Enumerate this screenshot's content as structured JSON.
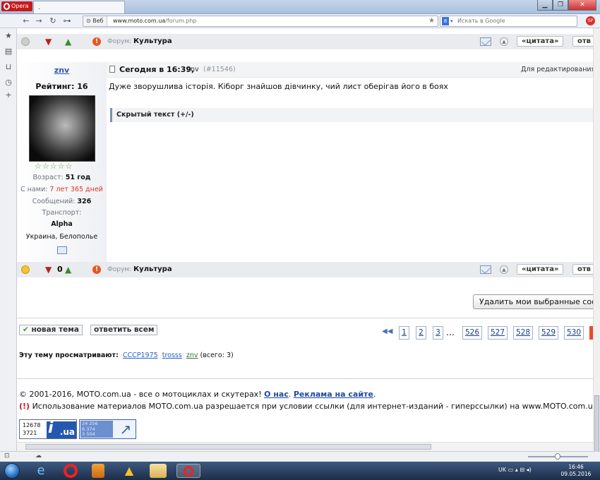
{
  "browser": {
    "app_name": "Opera",
    "tab_title": ".",
    "address_prefix": "Веб",
    "url_domain": "www.moto.com.ua",
    "url_path": "/forum.php",
    "search_placeholder": "Искать в Google",
    "search_engine_letter": "8",
    "sp_badge": "SP"
  },
  "post": {
    "top_bar": {
      "forum_label": "Форум:",
      "forum_name": "Культура",
      "quote_label": "«цитата»",
      "reply_label": "отв"
    },
    "author": {
      "name": "znv",
      "rating": "Рейтинг: 16",
      "age_label": "Возраст:",
      "age_value": "51 год",
      "since_label": "С нами:",
      "since_value": "7 лет 365 дней",
      "messages_label": "Сообщений:",
      "messages_value": "326",
      "transport_label": "Транспорт:",
      "transport_value": "Alpha",
      "location": "Украина, Белополье"
    },
    "header": {
      "date": "Сегодня в 16:39,",
      "author": "znv",
      "post_id": "(#11546)",
      "edit_note": "Для редактирования:"
    },
    "body": "Дуже зворушлива історія. Кіборг знайшов дівчинку, чий лист оберігав його в боях",
    "hidden_text_label": "Скрытый текст (+/-)",
    "bottom_bar": {
      "minus_count": "0",
      "forum_label": "Форум:",
      "forum_name": "Культура",
      "quote_label": "«цитата»",
      "reply_label": "отв"
    }
  },
  "delete_button": "Удалить мои выбранные сообщения",
  "thread_buttons": {
    "new_topic": "новая тема",
    "reply_all": "ответить всем"
  },
  "pagination": {
    "pages": [
      "1",
      "2",
      "3",
      "526",
      "527",
      "528",
      "529",
      "530"
    ],
    "ellipsis": "…"
  },
  "viewers": {
    "label": "Эту тему просматривают:",
    "users": [
      "CCCP1975",
      "trosss",
      "znv"
    ],
    "total": "(всего: 3)"
  },
  "footer": {
    "copyright": "© 2001-2016, MOTO.com.ua - все о мотоциклах и скутерах!",
    "about_link": "О нас",
    "ads_link": "Реклама на сайте",
    "notice_mark": "(!)",
    "notice": "Использование материалов MOTO.com.ua разрешается при условии ссылки (для интернет-изданий - гиперссылки) на www.MOTO.com.ua"
  },
  "counters": {
    "iua": {
      "value_1": "12678",
      "value_2": "3721",
      "logo": ".ua"
    },
    "second": {
      "line_1": "24 256",
      "line_2": "6 374",
      "line_3": "3 504"
    }
  },
  "taskbar": {
    "lang": "UK",
    "time": "16:46",
    "date": "09.05.2016"
  }
}
